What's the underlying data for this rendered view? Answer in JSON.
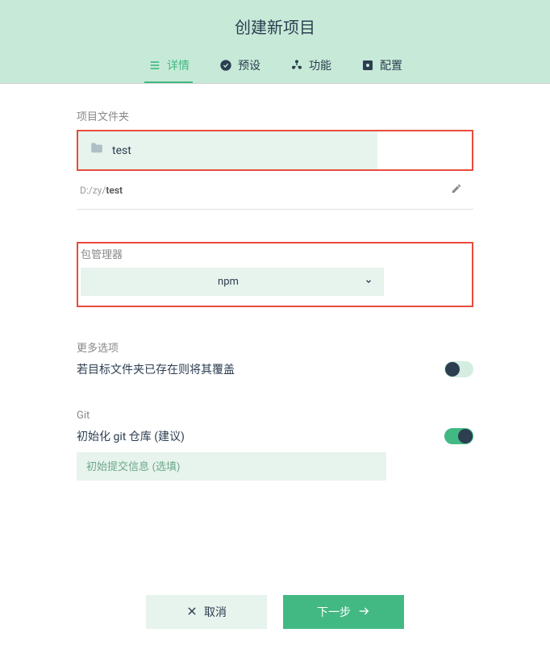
{
  "header": {
    "title": "创建新项目"
  },
  "tabs": [
    {
      "label": "详情",
      "icon": "list"
    },
    {
      "label": "预设",
      "icon": "check"
    },
    {
      "label": "功能",
      "icon": "puzzle"
    },
    {
      "label": "配置",
      "icon": "gear"
    }
  ],
  "folder": {
    "label": "项目文件夹",
    "name": "test",
    "path_prefix": "D:/zy/",
    "path_current": "test"
  },
  "package_manager": {
    "label": "包管理器",
    "selected": "npm"
  },
  "more_options": {
    "label": "更多选项",
    "overwrite_text": "若目标文件夹已存在则将其覆盖",
    "overwrite_on": false
  },
  "git": {
    "label": "Git",
    "init_text": "初始化 git 仓库 (建议)",
    "init_on": true,
    "commit_placeholder": "初始提交信息 (选填)"
  },
  "footer": {
    "cancel": "取消",
    "next": "下一步"
  }
}
